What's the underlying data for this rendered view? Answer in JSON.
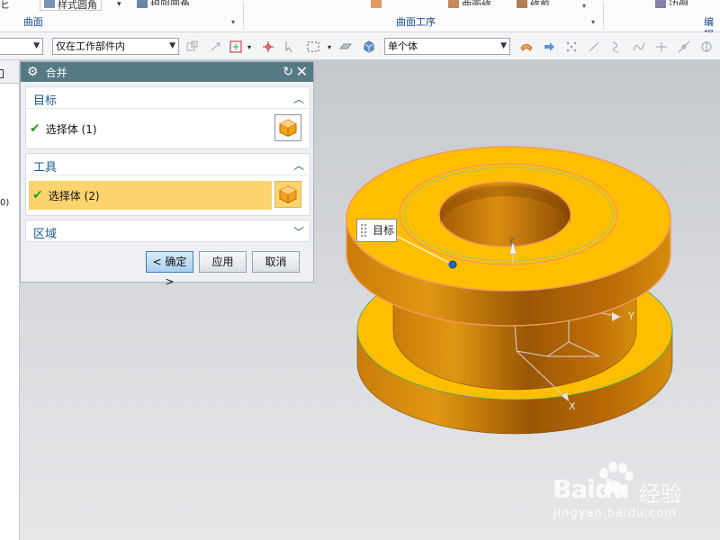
{
  "ribbon": {
    "left_fragment": "ヒ",
    "group1_button": "样式圆角",
    "group1_button2": "规则圆角",
    "group1_label": "曲面",
    "group2_button": "曲面修剪",
    "group2_button2": "修剪",
    "group2_label": "曲面工序",
    "group3_button": "边倒圆",
    "group3_label": "编辑"
  },
  "toolbar": {
    "filter_select": "",
    "scope_select": "仅在工作部件内",
    "body_rule_select": "单个体"
  },
  "dialog": {
    "title": "合并",
    "target": {
      "heading": "目标",
      "selection": "选择体 (1)"
    },
    "tool": {
      "heading": "工具",
      "selection": "选择体 (2)"
    },
    "region": {
      "heading": "区域"
    },
    "buttons": {
      "ok": "< 确定 >",
      "apply": "应用",
      "cancel": "取消"
    }
  },
  "viewport": {
    "callout_label": "目标",
    "axis_z": "Z",
    "axis_y": "Y",
    "axis_x": "X"
  },
  "left_strip": {
    "fragment": "0)"
  },
  "watermark": {
    "logo": "Baidu",
    "cn": "经验",
    "url": "jingyan.baidu.com"
  },
  "colors": {
    "dialog_title_bar": "#557a83",
    "selection_highlight": "#fbd46e",
    "model_orange": "#f5b800",
    "model_edge": "#f39a5c",
    "section_heading": "#1f5c8e"
  }
}
